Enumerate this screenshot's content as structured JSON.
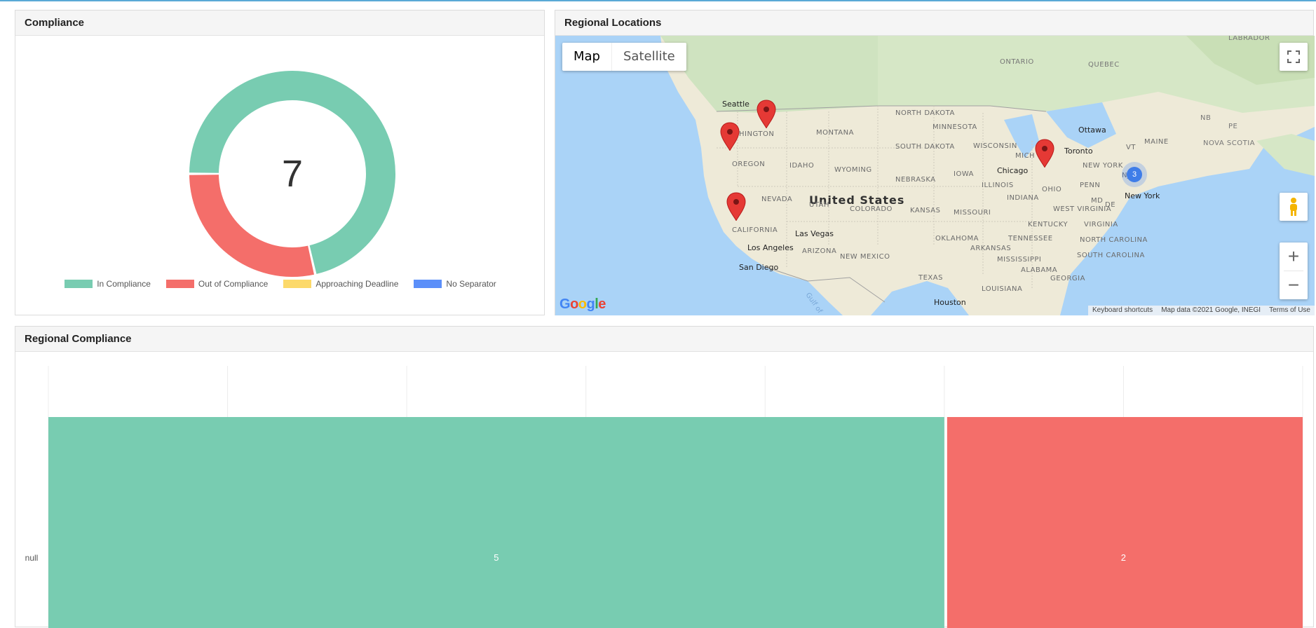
{
  "compliance": {
    "title": "Compliance",
    "total": "7",
    "legend": [
      {
        "label": "In Compliance",
        "color": "#78ccb1"
      },
      {
        "label": "Out of Compliance",
        "color": "#f46e6a"
      },
      {
        "label": "Approaching Deadline",
        "color": "#fcd96a"
      },
      {
        "label": "No Separator",
        "color": "#5b8ff9"
      }
    ],
    "slices": [
      {
        "label": "In Compliance",
        "value": 5,
        "color": "#78ccb1"
      },
      {
        "label": "Out of Compliance",
        "value": 2,
        "color": "#f46e6a"
      }
    ]
  },
  "regional_locations": {
    "title": "Regional Locations",
    "map_type_buttons": {
      "map": "Map",
      "satellite": "Satellite"
    },
    "google_logo": "Google",
    "attribution": {
      "shortcuts": "Keyboard shortcuts",
      "data": "Map data ©2021 Google, INEGI",
      "terms": "Terms of Use"
    },
    "cluster_count": "3",
    "labels": {
      "country": "United States",
      "states": [
        "WASHINGTON",
        "OREGON",
        "IDAHO",
        "MONTANA",
        "WYOMING",
        "NEVADA",
        "UTAH",
        "CALIFORNIA",
        "ARIZONA",
        "NEW MEXICO",
        "COLORADO",
        "NEBRASKA",
        "KANSAS",
        "NORTH DAKOTA",
        "SOUTH DAKOTA",
        "MINNESOTA",
        "IOWA",
        "MISSOURI",
        "OKLAHOMA",
        "TEXAS",
        "ARKANSAS",
        "LOUISIANA",
        "MISSISSIPPI",
        "ALABAMA",
        "GEORGIA",
        "TENNESSEE",
        "KENTUCKY",
        "ILLINOIS",
        "INDIANA",
        "OHIO",
        "WISCONSIN",
        "MICH",
        "PENN",
        "WEST VIRGINIA",
        "VIRGINIA",
        "NORTH CAROLINA",
        "SOUTH CAROLINA",
        "NEW YORK",
        "MAINE",
        "VT",
        "MD",
        "DE",
        "NJ"
      ],
      "provinces": [
        "ONTARIO",
        "QUEBEC",
        "NB",
        "PE",
        "NOVA SCOTIA",
        "LABRADOR"
      ],
      "cities": [
        "Seattle",
        "Las Vegas",
        "Los Angeles",
        "San Diego",
        "Chicago",
        "Toronto",
        "Ottawa",
        "New York",
        "Houston"
      ],
      "water": "Gulf of"
    }
  },
  "regional_compliance": {
    "title": "Regional Compliance"
  },
  "chart_data": {
    "type": "bar",
    "orientation": "horizontal-stacked",
    "categories": [
      "null"
    ],
    "series": [
      {
        "values": [
          5
        ],
        "color": "#78ccb1"
      },
      {
        "values": [
          2
        ],
        "color": "#f46e6a"
      }
    ],
    "xlim": [
      0,
      7
    ]
  }
}
